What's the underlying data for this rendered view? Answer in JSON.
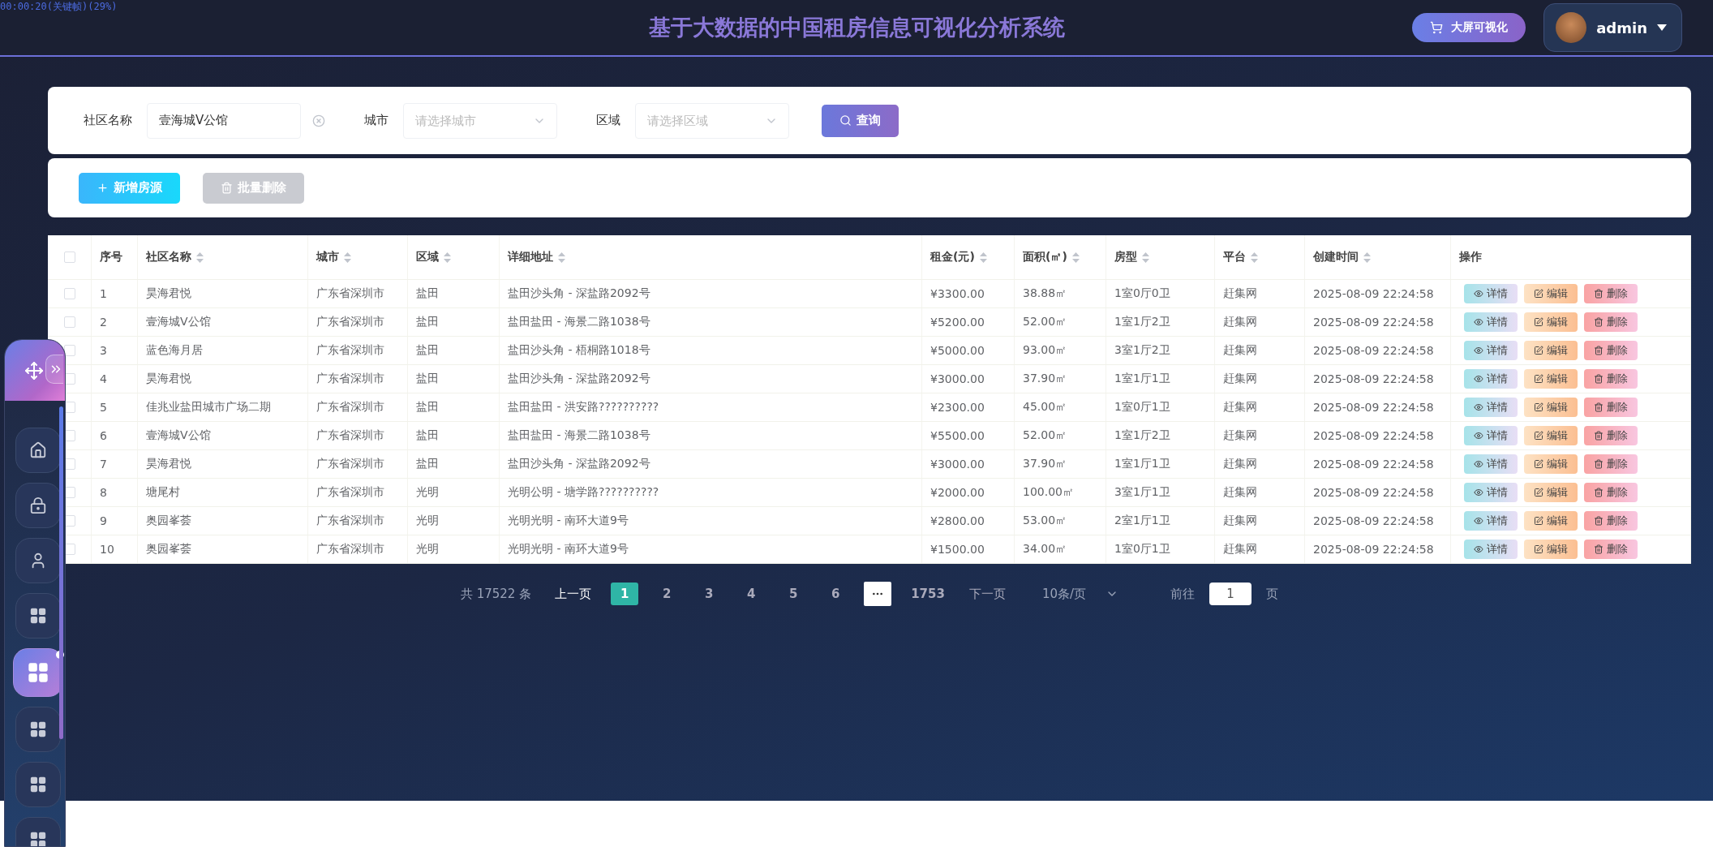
{
  "overlay_text": "00:00:20(关键帧)(29%)",
  "header": {
    "title": "基于大数据的中国租房信息可视化分析系统",
    "screen_button": "大屏可视化",
    "user": "admin"
  },
  "sidebar": {
    "items": [
      {
        "selected": false
      },
      {
        "selected": false
      },
      {
        "selected": false
      },
      {
        "selected": false
      },
      {
        "selected": true
      },
      {
        "selected": false
      },
      {
        "selected": false
      },
      {
        "selected": false
      }
    ]
  },
  "search": {
    "fields": [
      {
        "kind": "text",
        "label": "社区名称",
        "value": "壹海城V公馆"
      },
      {
        "kind": "select",
        "label": "城市",
        "placeholder": "请选择城市"
      },
      {
        "kind": "select",
        "label": "区域",
        "placeholder": "请选择区域"
      }
    ],
    "button": "查询"
  },
  "toolbar": [
    {
      "kind": "add",
      "label": "新增房源",
      "disabled": false
    },
    {
      "kind": "delete",
      "label": "批量删除",
      "disabled": true
    }
  ],
  "table": {
    "all_checked": false,
    "columns": [
      {
        "label": "序号",
        "kind": "plain"
      },
      {
        "label": "社区名称",
        "kind": "sort"
      },
      {
        "label": "城市",
        "kind": "sort"
      },
      {
        "label": "区域",
        "kind": "sort"
      },
      {
        "label": "详细地址",
        "kind": "sort"
      },
      {
        "label": "租金(元)",
        "kind": "sort"
      },
      {
        "label": "面积(㎡)",
        "kind": "sort"
      },
      {
        "label": "房型",
        "kind": "sort"
      },
      {
        "label": "平台",
        "kind": "sort"
      },
      {
        "label": "创建时间",
        "kind": "sort"
      },
      {
        "label": "操作",
        "kind": "plain"
      }
    ],
    "rows": [
      {
        "checked": false,
        "cells": [
          "1",
          "昊海君悦",
          "广东省深圳市",
          "盐田",
          "盐田沙头角 - 深盐路2092号",
          "¥3300.00",
          "38.88㎡",
          "1室0厅0卫",
          "赶集网",
          "2025-08-09 22:24:58"
        ],
        "actions": [
          "详情",
          "编辑",
          "删除"
        ]
      },
      {
        "checked": false,
        "cells": [
          "2",
          "壹海城V公馆",
          "广东省深圳市",
          "盐田",
          "盐田盐田 - 海景二路1038号",
          "¥5200.00",
          "52.00㎡",
          "1室1厅2卫",
          "赶集网",
          "2025-08-09 22:24:58"
        ],
        "actions": [
          "详情",
          "编辑",
          "删除"
        ]
      },
      {
        "checked": false,
        "cells": [
          "3",
          "蓝色海月居",
          "广东省深圳市",
          "盐田",
          "盐田沙头角 - 梧桐路1018号",
          "¥5000.00",
          "93.00㎡",
          "3室1厅2卫",
          "赶集网",
          "2025-08-09 22:24:58"
        ],
        "actions": [
          "详情",
          "编辑",
          "删除"
        ]
      },
      {
        "checked": false,
        "cells": [
          "4",
          "昊海君悦",
          "广东省深圳市",
          "盐田",
          "盐田沙头角 - 深盐路2092号",
          "¥3000.00",
          "37.90㎡",
          "1室1厅1卫",
          "赶集网",
          "2025-08-09 22:24:58"
        ],
        "actions": [
          "详情",
          "编辑",
          "删除"
        ]
      },
      {
        "checked": false,
        "cells": [
          "5",
          "佳兆业盐田城市广场二期",
          "广东省深圳市",
          "盐田",
          "盐田盐田 - 洪安路??????????",
          "¥2300.00",
          "45.00㎡",
          "1室0厅1卫",
          "赶集网",
          "2025-08-09 22:24:58"
        ],
        "actions": [
          "详情",
          "编辑",
          "删除"
        ]
      },
      {
        "checked": false,
        "cells": [
          "6",
          "壹海城V公馆",
          "广东省深圳市",
          "盐田",
          "盐田盐田 - 海景二路1038号",
          "¥5500.00",
          "52.00㎡",
          "1室1厅2卫",
          "赶集网",
          "2025-08-09 22:24:58"
        ],
        "actions": [
          "详情",
          "编辑",
          "删除"
        ]
      },
      {
        "checked": false,
        "cells": [
          "7",
          "昊海君悦",
          "广东省深圳市",
          "盐田",
          "盐田沙头角 - 深盐路2092号",
          "¥3000.00",
          "37.90㎡",
          "1室1厅1卫",
          "赶集网",
          "2025-08-09 22:24:58"
        ],
        "actions": [
          "详情",
          "编辑",
          "删除"
        ]
      },
      {
        "checked": false,
        "cells": [
          "8",
          "塘尾村",
          "广东省深圳市",
          "光明",
          "光明公明 - 塘学路??????????",
          "¥2000.00",
          "100.00㎡",
          "3室1厅1卫",
          "赶集网",
          "2025-08-09 22:24:58"
        ],
        "actions": [
          "详情",
          "编辑",
          "删除"
        ]
      },
      {
        "checked": false,
        "cells": [
          "9",
          "奥园峯荟",
          "广东省深圳市",
          "光明",
          "光明光明 - 南环大道9号",
          "¥2800.00",
          "53.00㎡",
          "2室1厅1卫",
          "赶集网",
          "2025-08-09 22:24:58"
        ],
        "actions": [
          "详情",
          "编辑",
          "删除"
        ]
      },
      {
        "checked": false,
        "cells": [
          "10",
          "奥园峯荟",
          "广东省深圳市",
          "光明",
          "光明光明 - 南环大道9号",
          "¥1500.00",
          "34.00㎡",
          "1室0厅1卫",
          "赶集网",
          "2025-08-09 22:24:58"
        ],
        "actions": [
          "详情",
          "编辑",
          "删除"
        ]
      }
    ]
  },
  "pagination": {
    "total": "共 17522 条",
    "prev": "上一页",
    "pages": [
      {
        "kind": "page",
        "label": "1",
        "selected": true
      },
      {
        "kind": "page",
        "label": "2",
        "selected": false
      },
      {
        "kind": "page",
        "label": "3",
        "selected": false
      },
      {
        "kind": "page",
        "label": "4",
        "selected": false
      },
      {
        "kind": "page",
        "label": "5",
        "selected": false
      },
      {
        "kind": "page",
        "label": "6",
        "selected": false
      },
      {
        "kind": "more"
      },
      {
        "kind": "page",
        "label": "1753",
        "selected": false
      }
    ],
    "next": "下一页",
    "page_size": "10条/页",
    "goto_label": "前往",
    "goto_value": "1",
    "goto_suffix": "页"
  }
}
